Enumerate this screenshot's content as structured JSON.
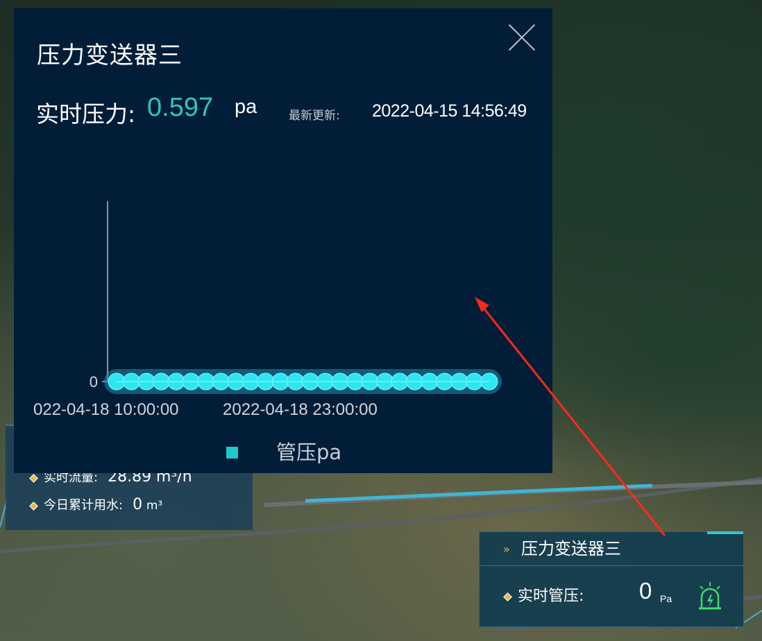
{
  "popup": {
    "title": "压力变送器三",
    "realtime_label": "实时压力:",
    "realtime_value": "0.597",
    "realtime_unit": "pa",
    "update_label": "最新更新:",
    "update_value": "2022-04-15 14:56:49",
    "legend_label": "管压pa",
    "close_icon": "close-icon"
  },
  "chart_data": {
    "type": "line",
    "x_tick_labels": [
      "022-04-18 10:00:00",
      "2022-04-18 23:00:00"
    ],
    "y_tick_labels": [
      "0"
    ],
    "series": [
      {
        "name": "管压pa",
        "color": "#1ec9c9",
        "values": [
          0,
          0,
          0,
          0,
          0,
          0,
          0,
          0,
          0,
          0,
          0,
          0,
          0,
          0,
          0,
          0,
          0,
          0,
          0,
          0,
          0,
          0,
          0,
          0,
          0,
          0
        ]
      }
    ]
  },
  "left_card": {
    "row1_label": "实时流量:",
    "row1_value": "28.89 m³/h",
    "row2_label": "今日累计用水:",
    "row2_value": "0",
    "row2_unit": "m³"
  },
  "right_card": {
    "title": "压力变送器三",
    "pressure_label": "实时管压:",
    "pressure_value": "0",
    "pressure_unit": "Pa",
    "alarm_icon": "alarm-light-icon",
    "accent_color": "#2ec6d6"
  },
  "colors": {
    "popup_bg": "#021d38",
    "value_color": "#2ec6c2",
    "annotation_arrow": "#ff2a1a"
  }
}
